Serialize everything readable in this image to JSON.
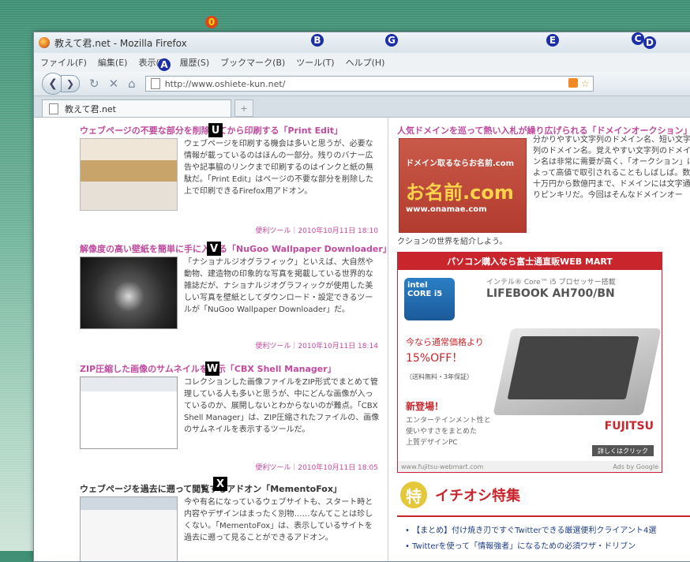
{
  "window": {
    "title": "教えて君.net - Mozilla Firefox"
  },
  "markers": {
    "zero": "0",
    "a": "A",
    "b": "B",
    "c": "C",
    "d": "D",
    "e": "E",
    "g": "G",
    "u": "U",
    "v": "V",
    "w": "W",
    "x": "X"
  },
  "menu": [
    "ファイル(F)",
    "編集(E)",
    "表示(V)",
    "履歴(S)",
    "ブックマーク(B)",
    "ツール(T)",
    "ヘルプ(H)"
  ],
  "nav": {
    "url": "http://www.oshiete-kun.net/"
  },
  "tabs": {
    "active": "教えて君.net",
    "new": "+"
  },
  "left": {
    "articles": [
      {
        "title": "ウェブページの不要な部分を削除してから印刷する「Print Edit」",
        "body": "ウェブページを印刷する機会は多いと思うが、必要な情報が載っているのはほんの一部分。残りのバナー広告や記事脇のリンクまで印刷するのはインクと紙の無駄だ。「Print Edit」はページの不要な部分を削除した上で印刷できるFirefox用アドオン。",
        "meta": "便利ツール｜2010年10月11日 18:10"
      },
      {
        "title": "解像度の高い壁紙を簡単に手に入れる「NuGoo Wallpaper Downloader」",
        "body": "「ナショナルジオグラフィック」といえば、大自然や動物、建造物の印象的な写真を掲載している世界的な雑誌だが、ナショナルジオグラフィックが使用した美しい写真を壁紙としてダウンロード・設定できるツールが「NuGoo Wallpaper Downloader」だ。",
        "meta": "便利ツール｜2010年10月11日 18:14"
      },
      {
        "title": "ZIP圧縮した画像のサムネイルを表示「CBX Shell Manager」",
        "body": "コレクションした画像ファイルをZIP形式でまとめて管理している人も多いと思うが、中にどんな画像が入っているのか、展開しないとわからないのが難点。「CBX Shell Manager」は、ZIP圧縮されたファイルの、画像のサムネイルを表示するツールだ。",
        "meta": "便利ツール｜2010年10月11日 18:05"
      },
      {
        "title": "ウェブページを過去に遡って閲覧するアドオン「MementoFox」",
        "body": "今や有名になっているウェブサイトも、スタート時と内容やデザインはまったく別物……なんてことは珍しくない。「MementoFox」は、表示しているサイトを過去に遡って見ることができるアドオン。",
        "meta": ""
      }
    ]
  },
  "right": {
    "title": "人気ドメインを巡って熱い入札が繰り広げられる「ドメインオークション」",
    "banner": {
      "top": "ドメイン取るならお名前.com",
      "brand": "お名前.com",
      "url": "www.onamae.com"
    },
    "body": "分かりやすい文字列のドメイン名、短い文字列のドメイン名。覚えやすい文字列のドメイン名は非常に需要が高く、「オークション」によって高値で取引されることもしばしば。数十万円から数億円まで、ドメインには文字通りピンキリだ。今回はそんなドメインオー",
    "tail": "クションの世界を紹介しよう。",
    "ad": {
      "header": "パソコン購入なら富士通直販WEB MART",
      "intel": "intel CORE i5",
      "sub": "インテル® Core™ i5 プロセッサー搭載",
      "model": "LIFEBOOK AH700/BN",
      "offer1": "今なら通常価格より",
      "offer2": "15%OFF！",
      "note": "（送料無料・3年保証）",
      "new": "新登場！",
      "desc1": "エンターテインメント性と",
      "desc2": "使いやすさをまとめた",
      "desc3": "上質デザインPC",
      "brand": "FUJITSU",
      "button": "詳しくはクリック",
      "foot_left": "www.fujitsu-webmart.com",
      "foot_right": "Ads by Google"
    },
    "feature": {
      "badge": "特",
      "title": "イチオシ特集",
      "items": [
        "【まとめ】付け焼き刃ですぐTwitterできる厳選便利クライアント4選",
        "Twitterを使って「情報強者」になるための必須ワザ・ドリブン"
      ]
    }
  }
}
